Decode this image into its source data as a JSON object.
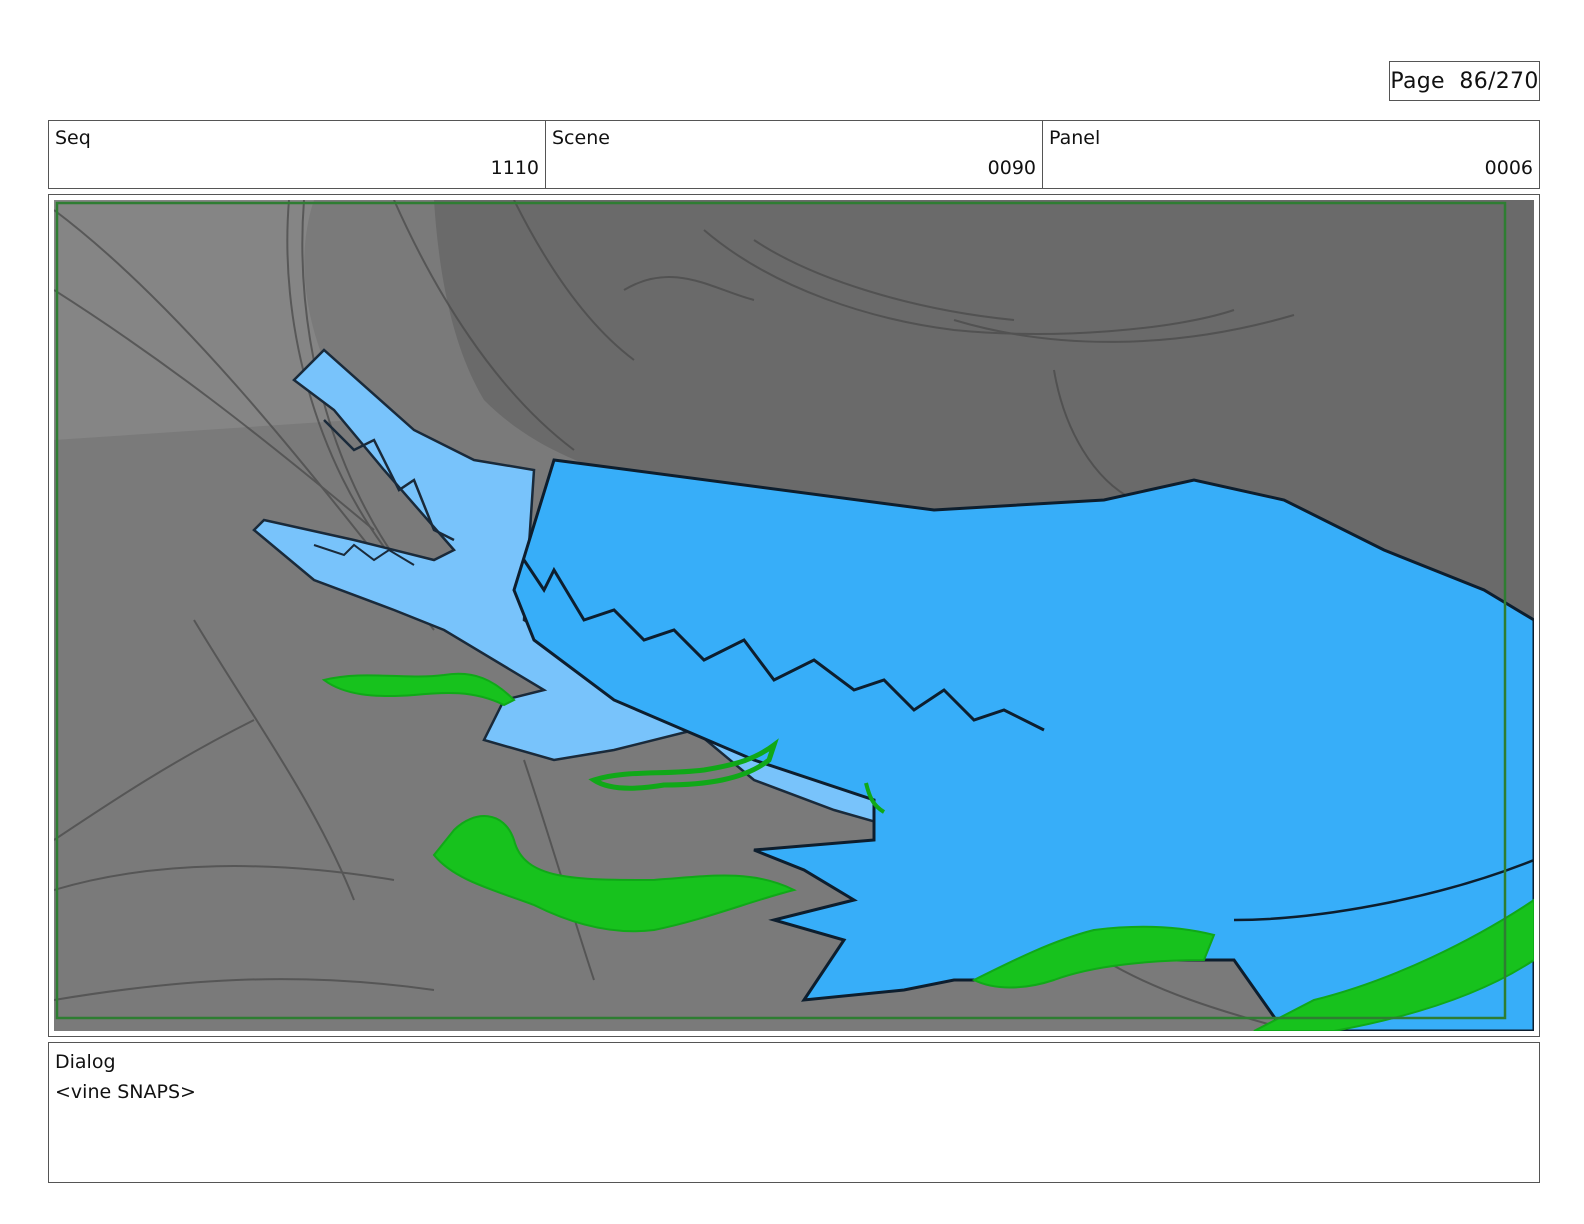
{
  "page": {
    "label": "Page",
    "number": "86/270"
  },
  "header": {
    "seq": {
      "label": "Seq",
      "value": "1110"
    },
    "scene": {
      "label": "Scene",
      "value": "0090"
    },
    "panel": {
      "label": "Panel",
      "value": "0006"
    }
  },
  "dialog": {
    "label": "Dialog",
    "text": "<vine SNAPS>"
  },
  "colors": {
    "background_dark": "#6a6a6a",
    "background_light": "#7c7c7c",
    "creature_main": "#37aef9",
    "creature_light": "#78c3fb",
    "vine": "#17c21d",
    "outline": "#0d1e2e",
    "safe_frame": "#2e7d32"
  }
}
